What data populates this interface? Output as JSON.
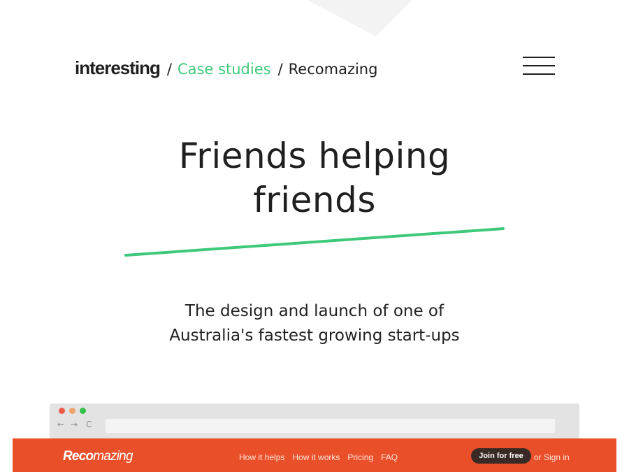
{
  "header": {
    "logo": "interesting",
    "separator": "/",
    "breadcrumb_link": "Case studies",
    "breadcrumb_current": "Recomazing"
  },
  "hero": {
    "title_line1": "Friends helping",
    "title_line2": "friends",
    "subtitle_line1": "The design and launch of one of",
    "subtitle_line2": "Australia's fastest growing start-ups"
  },
  "browser_preview": {
    "nav_back": "←",
    "nav_forward": "→",
    "nav_reload": "C",
    "site_logo_bold": "Reco",
    "site_logo_rest": "mazing",
    "nav_items": [
      "How it helps",
      "How it works",
      "Pricing",
      "FAQ"
    ],
    "join_label": "Join for free",
    "signin_label": "or Sign in"
  },
  "colors": {
    "accent_green": "#3ec97a",
    "brand_orange": "#e9502a",
    "text_dark": "#1f1f1f"
  }
}
